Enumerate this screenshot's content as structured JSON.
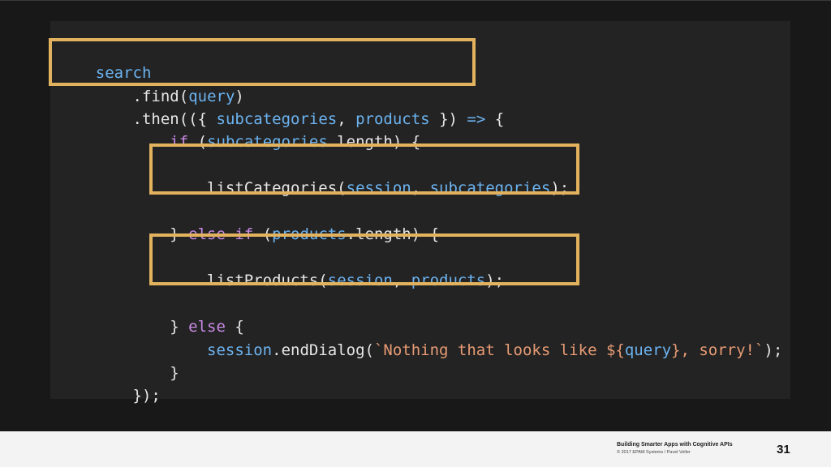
{
  "code": {
    "line1": {
      "t1": "search"
    },
    "line2": {
      "t1": "    .",
      "t2": "find",
      "t3": "(",
      "t4": "query",
      "t5": ")"
    },
    "line3": {
      "t1": "    .",
      "t2": "then",
      "t3": "(({ ",
      "t4": "subcategories",
      "t5": ", ",
      "t6": "products",
      "t7": " }) ",
      "t8": "=>",
      "t9": " {"
    },
    "line4": {
      "t1": "        ",
      "t2": "if",
      "t3": " (",
      "t4": "subcategories",
      "t5": ".",
      "t6": "length",
      "t7": ") {"
    },
    "line5": {
      "t1": "            listCategories(",
      "t2": "session",
      "t3": ", ",
      "t4": "subcategories",
      "t5": ");"
    },
    "line6": {
      "t1": "        } ",
      "t2": "else if",
      "t3": " (",
      "t4": "products",
      "t5": ".",
      "t6": "length",
      "t7": ") {"
    },
    "line7": {
      "t1": "            listProducts(",
      "t2": "session",
      "t3": ", ",
      "t4": "products",
      "t5": ");"
    },
    "line8": {
      "t1": "        } ",
      "t2": "else",
      "t3": " {"
    },
    "line9": {
      "t1": "            ",
      "t2": "session",
      "t3": ".endDialog(",
      "t4": "`Nothing that looks like ${",
      "t5": "query",
      "t6": "}, sorry!`",
      "t7": ");"
    },
    "line10": {
      "t1": "        }"
    },
    "line11": {
      "t1": "    });"
    }
  },
  "highlight_color": "#e2b25e",
  "footer": {
    "title": "Building Smarter Apps with Cognitive APIs",
    "copyright": "© 2017 EPAM Systems / Pavel Veller",
    "page_number": "31"
  }
}
